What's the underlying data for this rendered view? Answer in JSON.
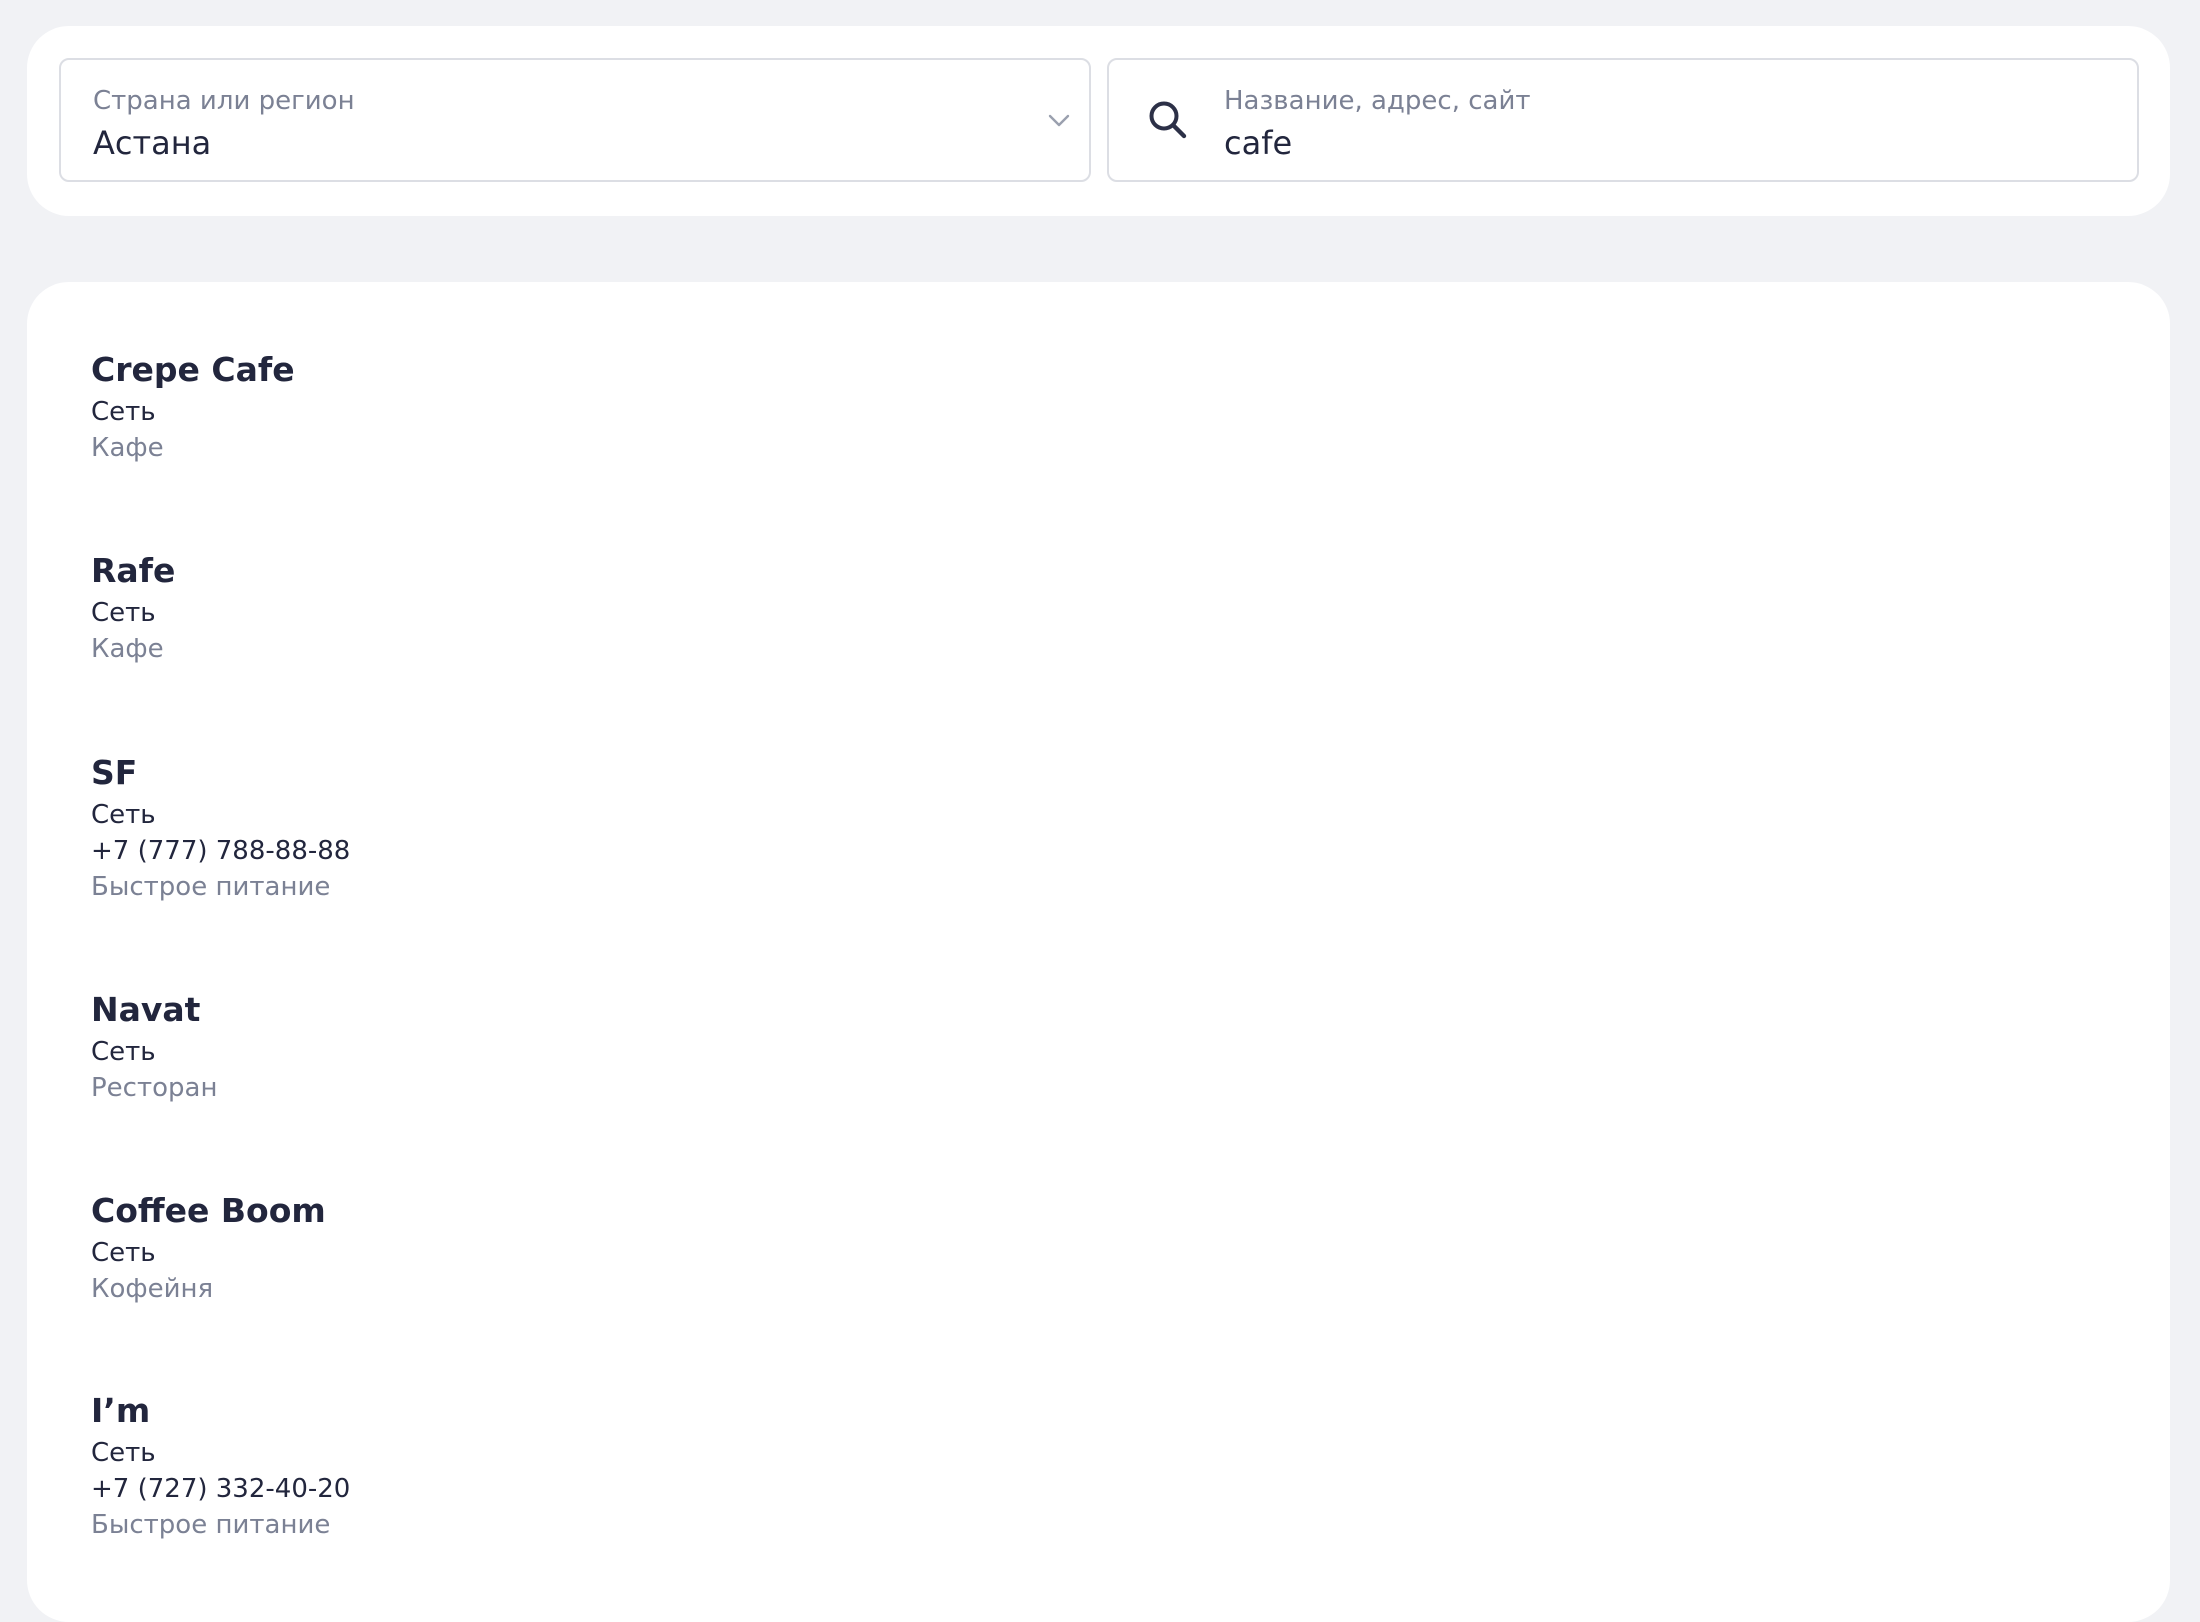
{
  "region_field": {
    "label": "Страна или регион",
    "value": "Астана",
    "icon": "chevron-down-icon"
  },
  "search_field": {
    "label": "Название, адрес, сайт",
    "value": "cafe",
    "icon": "search-icon"
  },
  "results": [
    {
      "name": "Crepe Cafe",
      "type": "Сеть",
      "phone": "",
      "category": "Кафе"
    },
    {
      "name": "Rafe",
      "type": "Сеть",
      "phone": "",
      "category": "Кафе"
    },
    {
      "name": "SF",
      "type": "Сеть",
      "phone": "+7 (777) 788-88-88",
      "category": "Быстрое питание"
    },
    {
      "name": "Navat",
      "type": "Сеть",
      "phone": "",
      "category": "Ресторан"
    },
    {
      "name": "Coffee Boom",
      "type": "Сеть",
      "phone": "",
      "category": "Кофейня"
    },
    {
      "name": "I’m",
      "type": "Сеть",
      "phone": "+7 (727) 332-40-20",
      "category": "Быстрое питание"
    }
  ]
}
